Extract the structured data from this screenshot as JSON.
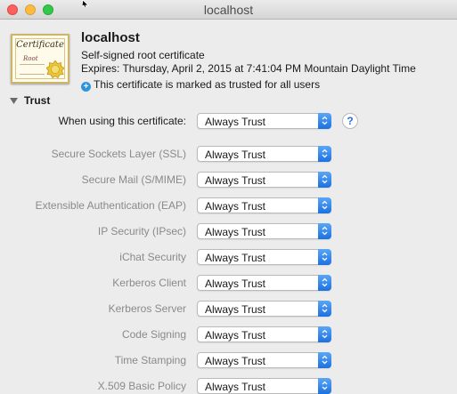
{
  "window": {
    "title": "localhost"
  },
  "certificate": {
    "icon_title": "Certificate",
    "icon_subtitle": "Root",
    "name": "localhost",
    "kind": "Self-signed root certificate",
    "expires": "Expires: Thursday, April 2, 2015 at 7:41:04 PM Mountain Daylight Time",
    "trust_status": "This certificate is marked as trusted for all users"
  },
  "trust": {
    "section_label": "Trust",
    "when_using": {
      "label": "When using this certificate:",
      "value": "Always Trust"
    },
    "help_label": "?",
    "rows": [
      {
        "label": "Secure Sockets Layer (SSL)",
        "value": "Always Trust"
      },
      {
        "label": "Secure Mail (S/MIME)",
        "value": "Always Trust"
      },
      {
        "label": "Extensible Authentication (EAP)",
        "value": "Always Trust"
      },
      {
        "label": "IP Security (IPsec)",
        "value": "Always Trust"
      },
      {
        "label": "iChat Security",
        "value": "Always Trust"
      },
      {
        "label": "Kerberos Client",
        "value": "Always Trust"
      },
      {
        "label": "Kerberos Server",
        "value": "Always Trust"
      },
      {
        "label": "Code Signing",
        "value": "Always Trust"
      },
      {
        "label": "Time Stamping",
        "value": "Always Trust"
      },
      {
        "label": "X.509 Basic Policy",
        "value": "Always Trust"
      }
    ]
  },
  "colors": {
    "accent": "#1c71e2",
    "disabled_label": "#8a8a8a",
    "close": "#fc605c",
    "minimize": "#fdbc40",
    "zoom": "#34c84a"
  }
}
